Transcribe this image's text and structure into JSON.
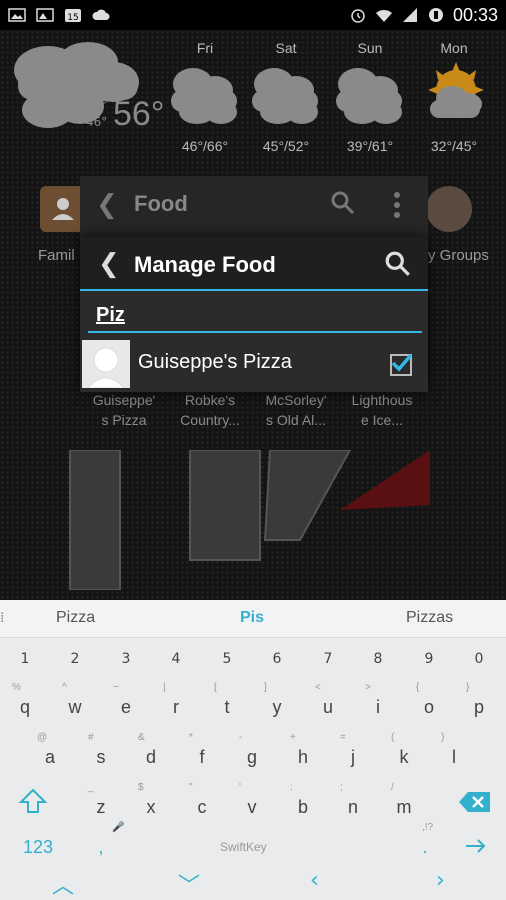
{
  "status_bar": {
    "time": "00:33",
    "left_icons": [
      "image-icon",
      "image-icon",
      "calendar-icon",
      "cloud-icon"
    ],
    "right_icons": [
      "alarm-icon",
      "wifi-icon",
      "signal-icon",
      "battery-icon"
    ]
  },
  "weather": {
    "current_temp": "56°",
    "current_hi": "66°",
    "current_lo": "46°",
    "forecast": [
      {
        "day": "Fri",
        "temps": "46°/66°",
        "icon": "cloudy-icon"
      },
      {
        "day": "Sat",
        "temps": "45°/52°",
        "icon": "cloudy-icon"
      },
      {
        "day": "Sun",
        "temps": "39°/61°",
        "icon": "cloudy-icon"
      },
      {
        "day": "Mon",
        "temps": "32°/45°",
        "icon": "partly-sunny-icon"
      }
    ]
  },
  "home": {
    "left_label": "Famil",
    "right_label": "y Groups"
  },
  "food_dialog": {
    "title": "Food"
  },
  "manage_dialog": {
    "title": "Manage Food",
    "search_value": "Piz",
    "results": [
      {
        "name": "Guiseppe's Pizza",
        "checked": true
      }
    ]
  },
  "tiles": [
    {
      "line1": "Guiseppe'",
      "line2": "s Pizza"
    },
    {
      "line1": "Robke's",
      "line2": "Country..."
    },
    {
      "line1": "McSorley'",
      "line2": "s Old Al..."
    },
    {
      "line1": "Lighthous",
      "line2": "e Ice..."
    }
  ],
  "keyboard": {
    "suggestions": [
      "Pizza",
      "Pis",
      "Pizzas"
    ],
    "numbers": [
      "1",
      "2",
      "3",
      "4",
      "5",
      "6",
      "7",
      "8",
      "9",
      "0"
    ],
    "row1": [
      {
        "k": "q",
        "alt": "%"
      },
      {
        "k": "w",
        "alt": "^"
      },
      {
        "k": "e",
        "alt": "~"
      },
      {
        "k": "r",
        "alt": "|"
      },
      {
        "k": "t",
        "alt": "["
      },
      {
        "k": "y",
        "alt": "]"
      },
      {
        "k": "u",
        "alt": "<"
      },
      {
        "k": "i",
        "alt": ">"
      },
      {
        "k": "o",
        "alt": "{"
      },
      {
        "k": "p",
        "alt": "}"
      }
    ],
    "row2": [
      {
        "k": "a",
        "alt": "@"
      },
      {
        "k": "s",
        "alt": "#"
      },
      {
        "k": "d",
        "alt": "&"
      },
      {
        "k": "f",
        "alt": "*"
      },
      {
        "k": "g",
        "alt": "-"
      },
      {
        "k": "h",
        "alt": "+"
      },
      {
        "k": "j",
        "alt": "="
      },
      {
        "k": "k",
        "alt": "("
      },
      {
        "k": "l",
        "alt": ")"
      }
    ],
    "row3": [
      {
        "k": "z",
        "alt": "_"
      },
      {
        "k": "x",
        "alt": "$"
      },
      {
        "k": "c",
        "alt": "\""
      },
      {
        "k": "v",
        "alt": "'"
      },
      {
        "k": "b",
        "alt": ":"
      },
      {
        "k": "n",
        "alt": ";"
      },
      {
        "k": "m",
        "alt": "/"
      }
    ],
    "num_switch": "123",
    "comma": ",",
    "period": ".",
    "period_alt": ",!?",
    "brand": "SwiftKey"
  }
}
